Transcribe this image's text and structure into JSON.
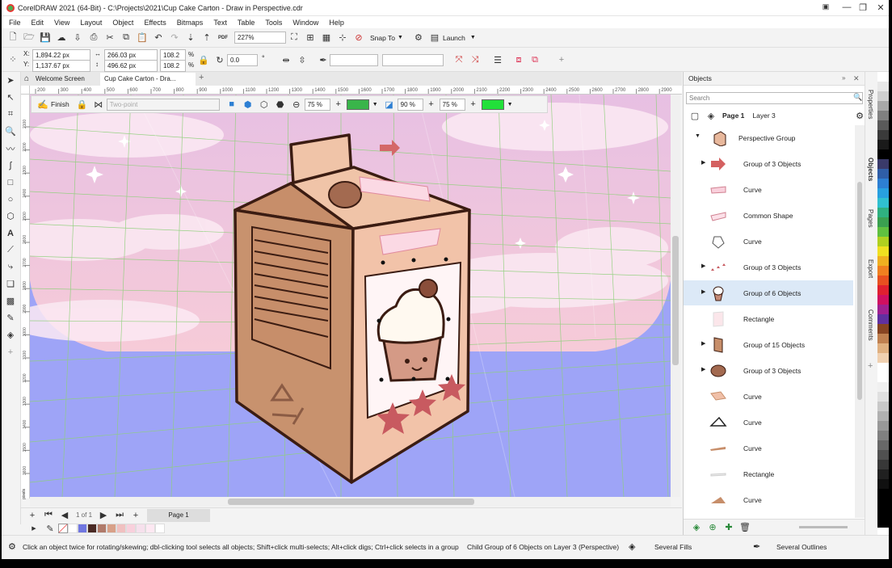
{
  "window": {
    "title": "CorelDRAW 2021 (64-Bit) - C:\\Projects\\2021\\Cup Cake Carton - Draw in Perspective.cdr"
  },
  "menu": [
    "File",
    "Edit",
    "View",
    "Layout",
    "Object",
    "Effects",
    "Bitmaps",
    "Text",
    "Table",
    "Tools",
    "Window",
    "Help"
  ],
  "toolbar": {
    "zoom": "227%",
    "snap_to": "Snap To",
    "launch": "Launch",
    "pdf": "PDF"
  },
  "props": {
    "x_label": "X:",
    "x": "1,894.22 px",
    "y_label": "Y:",
    "y": "1,137.67 px",
    "w": "266.03 px",
    "h": "496.62 px",
    "sx": "108.2",
    "sy": "108.2",
    "pct": "%",
    "angle": "0.0",
    "deg": "°"
  },
  "tabs": {
    "welcome": "Welcome Screen",
    "doc": "Cup Cake Carton - Dra..."
  },
  "ruler": [
    "200",
    "300",
    "400",
    "500",
    "600",
    "700",
    "800",
    "900",
    "1000",
    "1100",
    "1200",
    "1300",
    "1400",
    "1500",
    "1600",
    "1700",
    "1800",
    "1900",
    "2000",
    "2100",
    "2200",
    "2300",
    "2400",
    "2500",
    "2600",
    "2700",
    "2800",
    "2900"
  ],
  "ruler_v": [
    "2100",
    "2200",
    "2300",
    "2400",
    "2500",
    "2600",
    "2700",
    "2800",
    "2900",
    "3000",
    "3100",
    "3200",
    "3300",
    "3400",
    "3500",
    "3600",
    "3700"
  ],
  "ruler_unit": "pixels",
  "perspective_bar": {
    "finish": "Finish",
    "mode": "Two-point",
    "opacity1": "75 %",
    "opacity2": "90 %",
    "opacity3": "75 %"
  },
  "page_nav": {
    "of": "1 of 1",
    "page_tab": "Page 1"
  },
  "objects_panel": {
    "title": "Objects",
    "search_placeholder": "Search",
    "page": "Page 1",
    "layer": "Layer 3",
    "items": [
      {
        "label": "Perspective Group",
        "expanded": true
      },
      {
        "label": "Group of 3 Objects",
        "expand": true
      },
      {
        "label": "Curve"
      },
      {
        "label": "Common Shape"
      },
      {
        "label": "Curve"
      },
      {
        "label": "Group of 3 Objects",
        "expand": true
      },
      {
        "label": "Group of 6 Objects",
        "expand": true,
        "selected": true
      },
      {
        "label": "Rectangle"
      },
      {
        "label": "Group of 15 Objects",
        "expand": true
      },
      {
        "label": "Group of 3 Objects",
        "expand": true
      },
      {
        "label": "Curve"
      },
      {
        "label": "Curve"
      },
      {
        "label": "Curve"
      },
      {
        "label": "Rectangle"
      },
      {
        "label": "Curve"
      }
    ]
  },
  "docker_tabs": [
    "Properties",
    "Objects",
    "Pages",
    "Export",
    "Comments"
  ],
  "status": {
    "hint": "Click an object twice for rotating/skewing; dbl-clicking tool selects all objects; Shift+click multi-selects; Alt+click digs; Ctrl+click selects in a group",
    "selection": "Child Group of 6 Objects on Layer 3  (Perspective)",
    "fill": "Several Fills",
    "outline": "Several Outlines"
  },
  "colors": {
    "accent": "#2d7fd3",
    "selected_row": "#dce9f7",
    "canvas_pink": "#f4c6dc",
    "canvas_blue": "#9ea4f7",
    "carton": "#f0c4a8",
    "carton_dark": "#c78e6a",
    "outline": "#3b1c12"
  },
  "doc_palette": [
    "#ffffff",
    "#7076e0",
    "#4a2a24",
    "#b07a6a",
    "#d8a088",
    "#f0c0c0",
    "#f8d0dc",
    "#f6e0ec",
    "#fde8f2",
    "#ffffff"
  ],
  "side_palette": [
    "#ffffff",
    "#e8e8e8",
    "#d0d0d0",
    "#a8a8a8",
    "#808080",
    "#5a5a5a",
    "#3a3a3a",
    "#1a1a1a",
    "#000000",
    "#3a3a6a",
    "#2f5ea8",
    "#2d7fd3",
    "#28a0e0",
    "#30c0d0",
    "#2fb080",
    "#3aa050",
    "#60c040",
    "#b0d020",
    "#f0e020",
    "#f0b020",
    "#f08020",
    "#e85020",
    "#e02030",
    "#d01060",
    "#a02090",
    "#6030a0",
    "#884422",
    "#c08050",
    "#e0b080",
    "#f0d0b0",
    "#ffffff",
    "#ffffff",
    "#f0f0f0",
    "#e0e0e0",
    "#c8c8c8",
    "#b0b0b0",
    "#989898",
    "#808080",
    "#686868",
    "#505050",
    "#383838",
    "#202020",
    "#101010",
    "#000000",
    "#000000",
    "#000000",
    "#000000"
  ]
}
